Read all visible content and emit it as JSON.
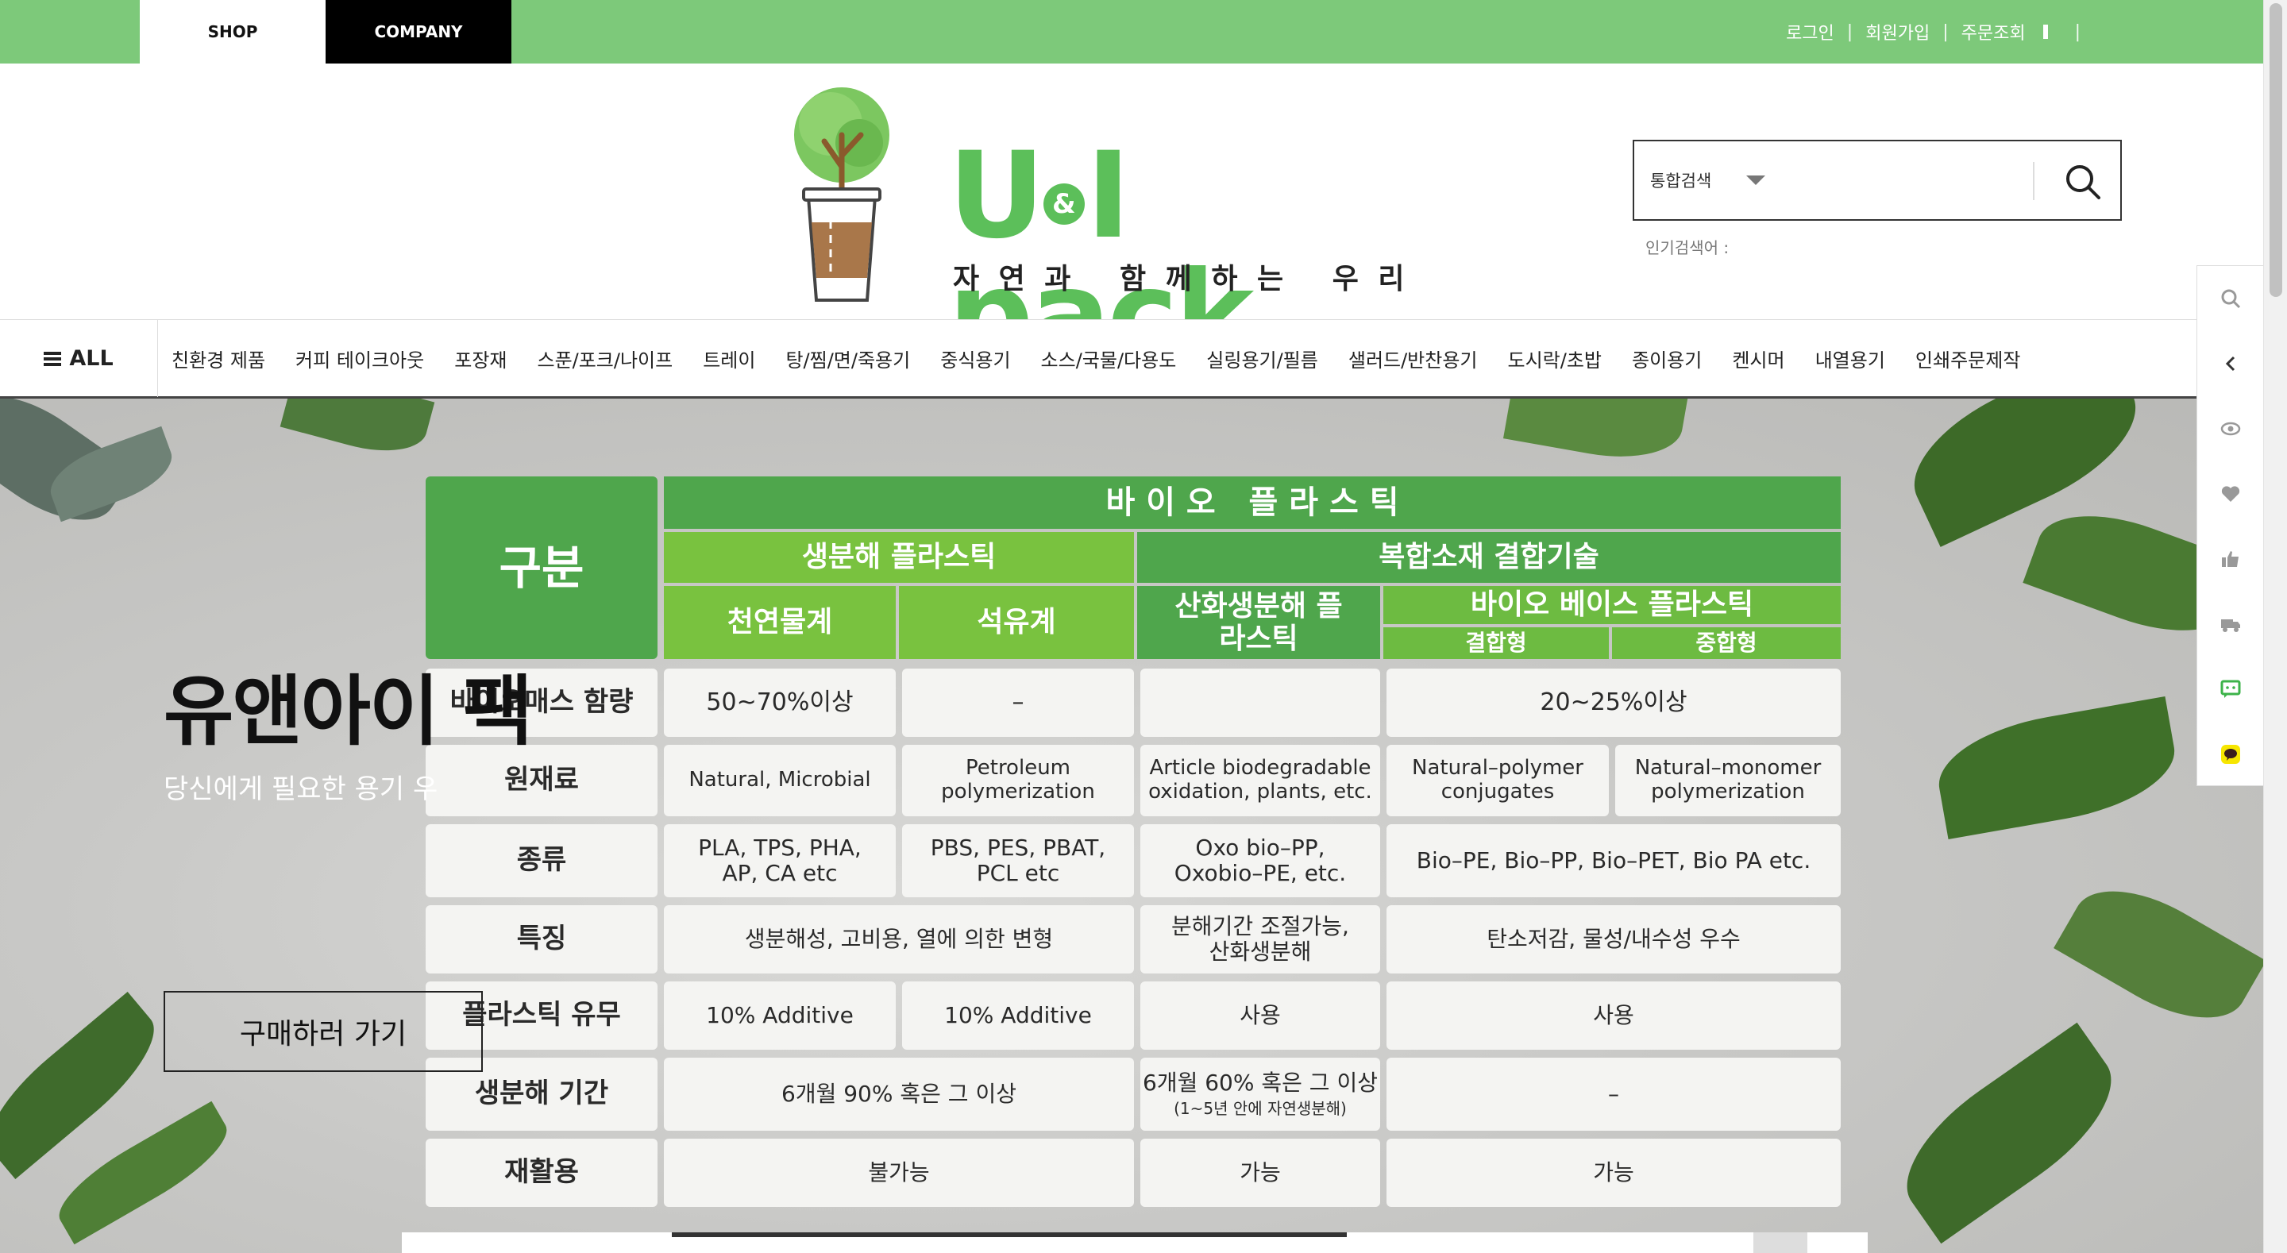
{
  "topbar": {
    "tabs": [
      "SHOP",
      "COMPANY"
    ],
    "links": [
      "로그인",
      "회원가입",
      "주문조회"
    ]
  },
  "brand": {
    "name_part1": "U",
    "name_amp": "&",
    "name_part2": "I pack",
    "slogan": "자 연 과   함 께 하 는   우 리"
  },
  "search": {
    "scope": "통합검색",
    "popular_label": "인기검색어 :"
  },
  "nav": {
    "all_label": "ALL",
    "items": [
      "친환경 제품",
      "커피 테이크아웃",
      "포장재",
      "스푼/포크/나이프",
      "트레이",
      "탕/찜/면/죽용기",
      "중식용기",
      "소스/국물/다용도",
      "실링용기/필름",
      "샐러드/반찬용기",
      "도시락/초밥",
      "종이용기",
      "켄시머",
      "내열용기",
      "인쇄주문제작"
    ]
  },
  "hero": {
    "title": "유앤아이 팩",
    "subtitle": "당신에게 필요한 용기 우",
    "button": "구매하러 가기"
  },
  "table": {
    "corner": "구분",
    "top_header": "바 이 오   플 라 스 틱",
    "group_biodeg": "생분해 플라스틱",
    "group_composite": "복합소재 결합기술",
    "col_natural": "천연물계",
    "col_petro": "석유계",
    "col_oxo": "산화생분해 플라스틱",
    "col_biobase": "바이오 베이스 플라스틱",
    "col_bond": "결합형",
    "col_poly": "중합형",
    "rows": [
      {
        "label": "바이오매스 함량",
        "c1": "50~70%이상",
        "c2": "–",
        "c3": "",
        "c45": "20~25%이상"
      },
      {
        "label": "원재료",
        "c1": "Natural, Microbial",
        "c2": "Petroleum polymerization",
        "c3": "Article biodegradable oxidation, plants, etc.",
        "c4": "Natural–polymer conjugates",
        "c5": "Natural–monomer polymerization"
      },
      {
        "label": "종류",
        "c1": "PLA, TPS, PHA, AP, CA etc",
        "c2": "PBS, PES, PBAT, PCL etc",
        "c3": "Oxo bio–PP, Oxobio–PE, etc.",
        "c45": "Bio–PE, Bio–PP, Bio–PET, Bio PA etc."
      },
      {
        "label": "특징",
        "c12": "생분해성, 고비용, 열에 의한 변형",
        "c3": "분해기간 조절가능, 산화생분해",
        "c45": "탄소저감, 물성/내수성 우수"
      },
      {
        "label": "플라스틱 유무",
        "c1": "10% Additive",
        "c2": "10% Additive",
        "c3": "사용",
        "c45": "사용"
      },
      {
        "label": "생분해 기간",
        "c12": "6개월 90% 혹은 그 이상",
        "c3": "6개월 60% 혹은 그 이상",
        "c3_note": "(1~5년 안에 자연생분해)",
        "c45": "–"
      },
      {
        "label": "재활용",
        "c12": "불가능",
        "c3": "가능",
        "c45": "가능"
      }
    ]
  },
  "colors": {
    "topbar": "#7dc97a",
    "brand_green": "#5cbf5a",
    "table_dark": "#4fa64c",
    "table_light": "#79c23f"
  },
  "rail_icons": [
    "search-icon",
    "chevron-left-icon",
    "eye-icon",
    "heart-icon",
    "thumbs-up-icon",
    "truck-icon",
    "chat-green-icon",
    "kakao-talk-icon"
  ]
}
